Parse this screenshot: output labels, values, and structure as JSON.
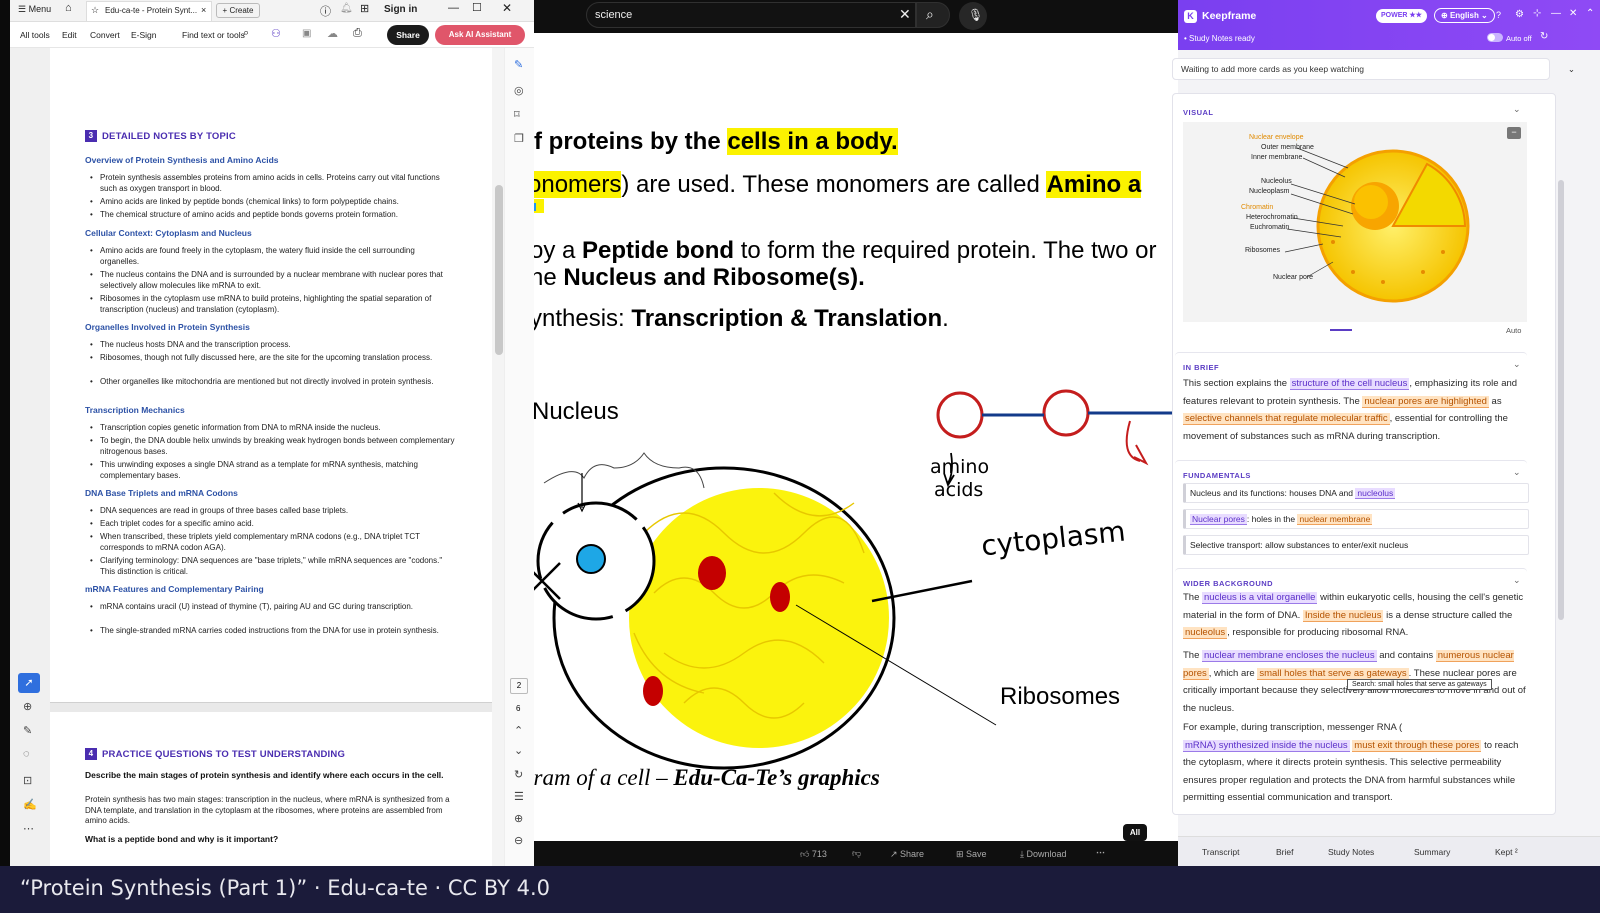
{
  "pdf": {
    "menu_label": "Menu",
    "tab_title": "Edu-ca-te - Protein Synt...",
    "create_label": "Create",
    "sign_in": "Sign in",
    "toolbar": {
      "all_tools": "All tools",
      "edit": "Edit",
      "convert": "Convert",
      "esign": "E-Sign",
      "find": "Find text or tools",
      "share": "Share",
      "ask_ai": "Ask AI Assistant"
    },
    "section3": {
      "num": "3",
      "title": "DETAILED NOTES BY TOPIC",
      "topics": [
        {
          "title": "Overview of Protein Synthesis and Amino Acids",
          "bullets": [
            "Protein synthesis assembles proteins from amino acids in cells. Proteins carry out vital functions such as oxygen transport in blood.",
            "Amino acids are linked by peptide bonds (chemical links) to form polypeptide chains.",
            "The chemical structure of amino acids and peptide bonds governs protein formation."
          ]
        },
        {
          "title": "Cellular Context: Cytoplasm and Nucleus",
          "bullets": [
            "Amino acids are found freely in the cytoplasm, the watery fluid inside the cell surrounding organelles.",
            "The nucleus contains the DNA and is surrounded by a nuclear membrane with nuclear pores that selectively allow molecules like mRNA to exit.",
            "Ribosomes in the cytoplasm use mRNA to build proteins, highlighting the spatial separation of transcription (nucleus) and translation (cytoplasm)."
          ]
        },
        {
          "title": "Organelles Involved in Protein Synthesis",
          "bullets": [
            "The nucleus hosts DNA and the transcription process.",
            "Ribosomes, though not fully discussed here, are the site for the upcoming translation process.",
            "Other organelles like mitochondria are mentioned but not directly involved in protein synthesis."
          ]
        },
        {
          "title": "Transcription Mechanics",
          "bullets": [
            "Transcription copies genetic information from DNA to mRNA inside the nucleus.",
            "To begin, the DNA double helix unwinds by breaking weak hydrogen bonds between complementary nitrogenous bases.",
            "This unwinding exposes a single DNA strand as a template for mRNA synthesis, matching complementary bases."
          ]
        },
        {
          "title": "DNA Base Triplets and mRNA Codons",
          "bullets": [
            "DNA sequences are read in groups of three bases called base triplets.",
            "Each triplet codes for a specific amino acid.",
            "When transcribed, these triplets yield complementary mRNA codons (e.g., DNA triplet TCT corresponds to mRNA codon AGA).",
            "Clarifying terminology: DNA sequences are \"base triplets,\" while mRNA sequences are \"codons.\" This distinction is critical."
          ]
        },
        {
          "title": "mRNA Features and Complementary Pairing",
          "bullets": [
            "mRNA contains uracil (U) instead of thymine (T), pairing AU and GC during transcription.",
            "The single-stranded mRNA carries coded instructions from the DNA for use in protein synthesis."
          ]
        }
      ]
    },
    "section4": {
      "num": "4",
      "title": "PRACTICE QUESTIONS TO TEST UNDERSTANDING",
      "q1": "Describe the main stages of protein synthesis and identify where each occurs in the cell.",
      "a1": "Protein synthesis has two main stages: transcription in the nucleus, where mRNA is synthesized from a DNA template, and translation in the cytoplasm at the ribosomes, where proteins are assembled from amino acids.",
      "q2": "What is a peptide bond and why is it important?"
    },
    "page_current": "2",
    "page_total": "6"
  },
  "video": {
    "search_value": "science",
    "lines": {
      "l1a": "f proteins by the ",
      "l1b": "cells in a body.",
      "l2a": "onomers",
      "l2b": ") are used. These monomers are called ",
      "l2c": "Amino a",
      "l3a": "oy a ",
      "l3b": "Peptide bond",
      "l3c": " to form the required protein. The two or",
      "l4a": "he ",
      "l4b": "Nucleus and Ribosome(s).",
      "l5a": "ynthesis: ",
      "l5b": "Transcription & Translation",
      "l5c": "."
    },
    "labels": {
      "nucleus": "Nucleus",
      "cytoplasm": "cytoplasm",
      "amino": "amino",
      "acids": "acids",
      "ribosomes": "Ribosomes",
      "caption_a": "gram of a cell – ",
      "caption_b": "Edu-Ca-Te’s graphics"
    },
    "actions": {
      "likes": "713",
      "share": "Share",
      "save": "Save",
      "download": "Download",
      "all": "All"
    }
  },
  "keepframe": {
    "title": "Keepframe",
    "power": "POWER ★★",
    "language": "English",
    "status": "Study Notes ready",
    "auto_off": "Auto off",
    "waiting": "Waiting to add more cards as you keep watching",
    "visual": {
      "label": "VISUAL",
      "auto": "Auto",
      "diagram": {
        "nuclear_envelope": "Nuclear envelope",
        "outer": "Outer membrane",
        "inner": "Inner membrane",
        "nucleolus": "Nucleolus",
        "nucleoplasm": "Nucleoplasm",
        "chromatin": "Chromatin",
        "hetero": "Heterochromatin",
        "eu": "Euchromatin",
        "ribosomes": "Ribosomes",
        "pore": "Nuclear pore"
      }
    },
    "in_brief": {
      "label": "IN BRIEF",
      "t1": "This section explains the ",
      "h1": "structure of the cell nucleus",
      "t2": ", emphasizing its role and features relevant to protein synthesis. The ",
      "h2": "nuclear pores are highlighted",
      "t3": " as ",
      "h3": "selective channels that regulate molecular traffic",
      "t4": ", essential for controlling the movement of substances such as mRNA during transcription."
    },
    "fundamentals": {
      "label": "FUNDAMENTALS",
      "f1a": "Nucleus and its functions: houses DNA and ",
      "f1b": "nucleolus",
      "f2a": "Nuclear pores",
      "f2b": ": holes in the ",
      "f2c": "nuclear membrane",
      "f3": "Selective transport: allow substances to enter/exit nucleus"
    },
    "wider": {
      "label": "WIDER BACKGROUND",
      "p1a": "The ",
      "p1b": "nucleus is a vital organelle",
      "p1c": " within eukaryotic cells, housing the cell's genetic material in the form of DNA. ",
      "p1d": "Inside the nucleus",
      "p1e": " is a dense structure called the ",
      "p1f": "nucleolus",
      "p1g": ", responsible for producing ribosomal RNA.",
      "p2a": "The ",
      "p2b": "nuclear membrane encloses the nucleus",
      "p2c": " and contains ",
      "p2d": "numerous nuclear pores",
      "p2e": ", which are ",
      "p2f": "small holes that serve as gateways",
      "p2g": ". These nuclear pores are critically important because they selectively allow molecules to move in and out of the nucleus.",
      "tooltip": "Search: small holes that serve as gateways",
      "p3a": "For example, during transcription, messenger RNA (",
      "p3b": "mRNA) synthesized inside the nucleus",
      "p3c": "must exit through these pores",
      "p3d": " to reach the cytoplasm, where it directs protein synthesis. This selective permeability ensures proper regulation and protects the DNA from harmful substances while permitting essential communication and transport."
    },
    "tabs": [
      "Transcript",
      "Brief",
      "Study Notes",
      "Summary",
      "Kept ²"
    ]
  },
  "caption": "“Protein Synthesis (Part 1)” · Edu-ca-te · CC BY 4.0",
  "colors": {
    "accent": "#7a3ff0",
    "highlight_yellow": "#fbf200",
    "pdf_heading": "#4a2db0"
  }
}
